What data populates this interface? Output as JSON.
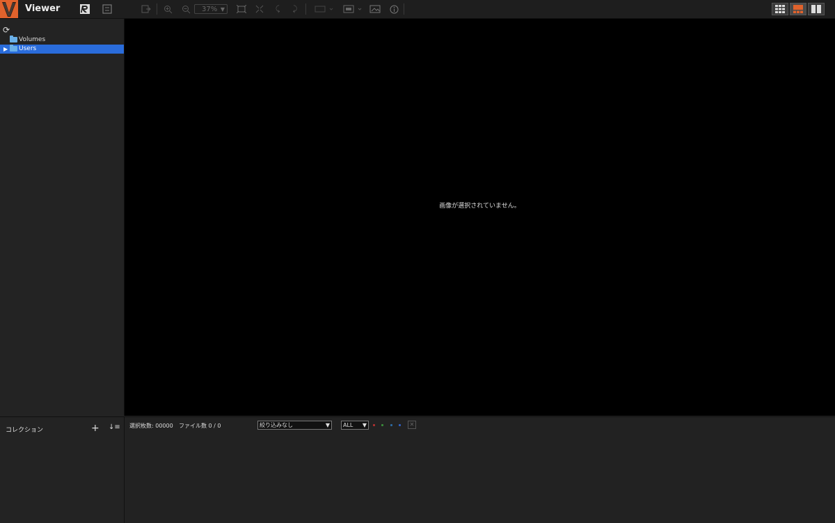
{
  "app": {
    "title": "Viewer",
    "logo_letter": "V",
    "brand_color": "#e0622c"
  },
  "toolbar": {
    "zoom_value": "37%"
  },
  "sidebar": {
    "items": [
      {
        "label": "Volumes",
        "selected": false
      },
      {
        "label": "Users",
        "selected": true
      }
    ]
  },
  "viewer": {
    "empty_message": "画像が選択されていません。"
  },
  "collection": {
    "title": "コレクション"
  },
  "status": {
    "selected_count": "選択枚数: 00000",
    "file_count": "ファイル数 0 / 0",
    "filter_value": "絞り込みなし",
    "rating_value": "ALL",
    "color_labels": [
      "#b03030",
      "#3a8a3a",
      "#2e6aa0",
      "#3060c0"
    ]
  }
}
